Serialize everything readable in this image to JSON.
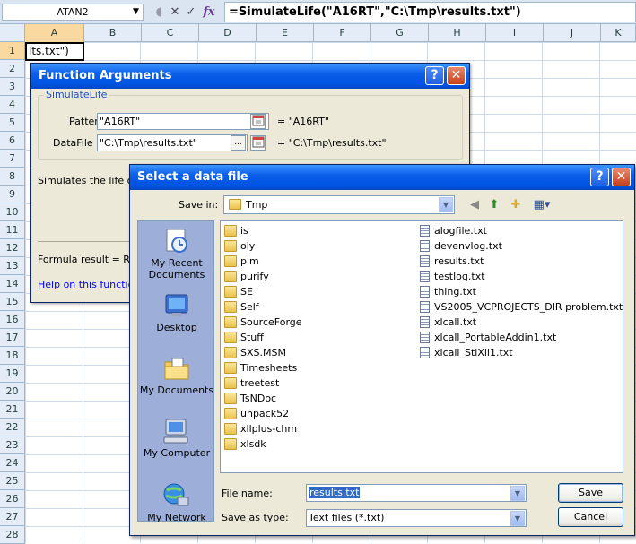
{
  "formula_bar": {
    "name_box": "ATAN2",
    "cancel_glyph": "✕",
    "enter_glyph": "✓",
    "fx_glyph": "fx",
    "formula": "=SimulateLife(\"A16RT\",\"C:\\Tmp\\results.txt\")"
  },
  "sheet": {
    "columns": [
      "A",
      "B",
      "C",
      "D",
      "E",
      "F",
      "G",
      "H",
      "I",
      "J",
      "K"
    ],
    "selected_column": "A",
    "rows": [
      "1",
      "2",
      "3",
      "4",
      "5",
      "6",
      "7",
      "8",
      "9",
      "10",
      "11",
      "12",
      "13",
      "14",
      "15",
      "16",
      "17",
      "18",
      "19",
      "20",
      "21",
      "22",
      "23",
      "24",
      "25",
      "26",
      "27",
      "28"
    ],
    "selected_row": "1",
    "cell_a1": "lts.txt\")"
  },
  "function_args": {
    "title": "Function Arguments",
    "help_glyph": "?",
    "close_glyph": "✕",
    "group_label": "SimulateLife",
    "pattern_label": "Pattern",
    "pattern_value": "\"A16RT\"",
    "pattern_eval": "=  \"A16RT\"",
    "datafile_label": "DataFile",
    "datafile_value": "\"C:\\Tmp\\results.txt\"",
    "datafile_eval": "=  \"C:\\Tmp\\results.txt\"",
    "browse_label": "...",
    "description": "Simulates the life of t",
    "formula_result": "Formula result =    Re",
    "help_link": "Help on this function"
  },
  "select_file": {
    "title": "Select a data file",
    "help_glyph": "?",
    "close_glyph": "✕",
    "save_in_label": "Save in:",
    "save_in_value": "Tmp",
    "places": [
      {
        "label": "My Recent Documents",
        "icon": "recent-documents-icon"
      },
      {
        "label": "Desktop",
        "icon": "desktop-icon"
      },
      {
        "label": "My Documents",
        "icon": "my-documents-icon"
      },
      {
        "label": "My Computer",
        "icon": "my-computer-icon"
      },
      {
        "label": "My Network",
        "icon": "my-network-icon"
      }
    ],
    "folders": [
      "is",
      "oly",
      "plm",
      "purify",
      "SE",
      "Self",
      "SourceForge",
      "Stuff",
      "SXS.MSM",
      "Timesheets",
      "treetest",
      "TsNDoc",
      "unpack52",
      "xllplus-chm",
      "xlsdk"
    ],
    "files": [
      "alogfile.txt",
      "devenvlog.txt",
      "results.txt",
      "testlog.txt",
      "thing.txt",
      "VS2005_VCPROJECTS_DIR problem.txt",
      "xlcall.txt",
      "xlcall_PortableAddin1.txt",
      "xlcall_StlXll1.txt"
    ],
    "file_name_label": "File name:",
    "file_name_value": "results.txt",
    "save_as_type_label": "Save as type:",
    "save_as_type_value": "Text files (*.txt)",
    "save_button": "Save",
    "cancel_button": "Cancel"
  }
}
